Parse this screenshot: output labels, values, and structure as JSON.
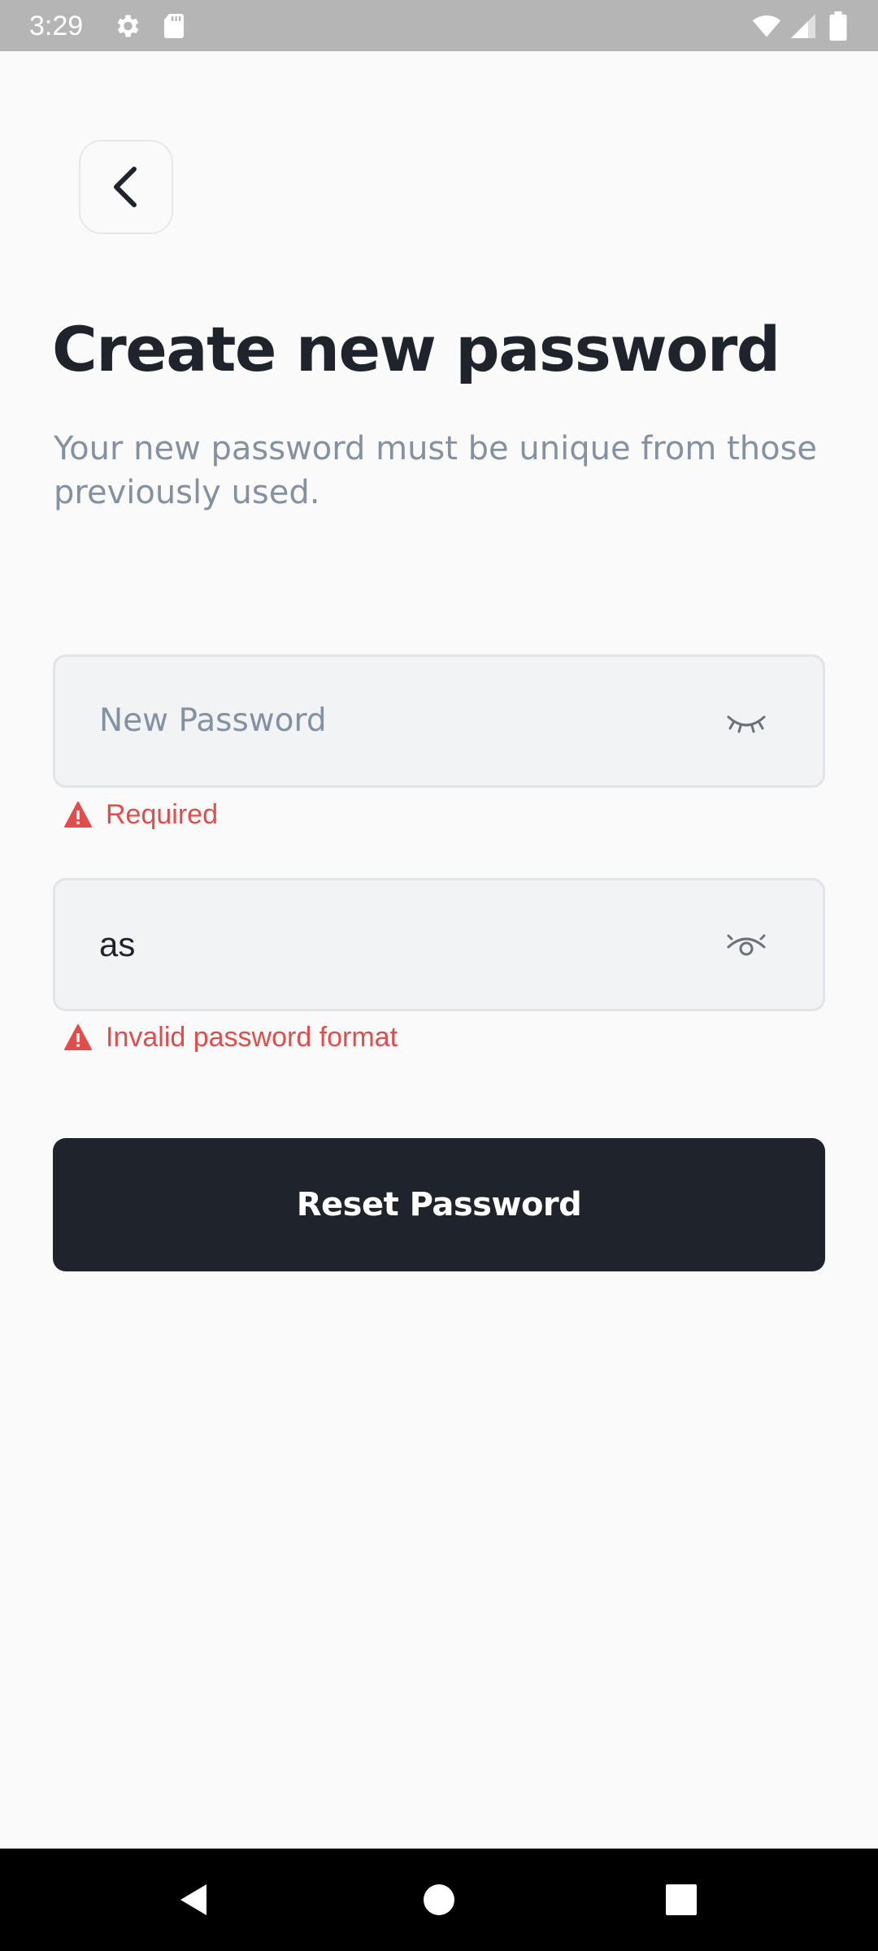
{
  "status_bar": {
    "time": "3:29",
    "left_icons": [
      "gear-icon",
      "sd-card-icon"
    ],
    "right_icons": [
      "wifi-icon",
      "cellular-signal-icon",
      "battery-icon"
    ],
    "background": "#B5B5B5"
  },
  "header": {
    "back_icon": "chevron-left-icon"
  },
  "main": {
    "title": "Create new password",
    "subtitle": "Your new password must be unique from those previously used.",
    "fields": [
      {
        "placeholder": "New Password",
        "value": "",
        "toggle_icon": "eye-closed-icon",
        "error": "Required"
      },
      {
        "placeholder": "",
        "value": "as",
        "toggle_icon": "eye-open-icon",
        "error": "Invalid password format"
      }
    ],
    "submit_label": "Reset Password"
  },
  "nav_bar": {
    "buttons": [
      "back-triangle-icon",
      "home-circle-icon",
      "recents-square-icon"
    ]
  },
  "colors": {
    "primary": "#1E232C",
    "error": "#E24C4B",
    "muted_text": "#8391A1",
    "field_bg": "#F2F3F5",
    "page_bg": "#FAFAFA"
  }
}
